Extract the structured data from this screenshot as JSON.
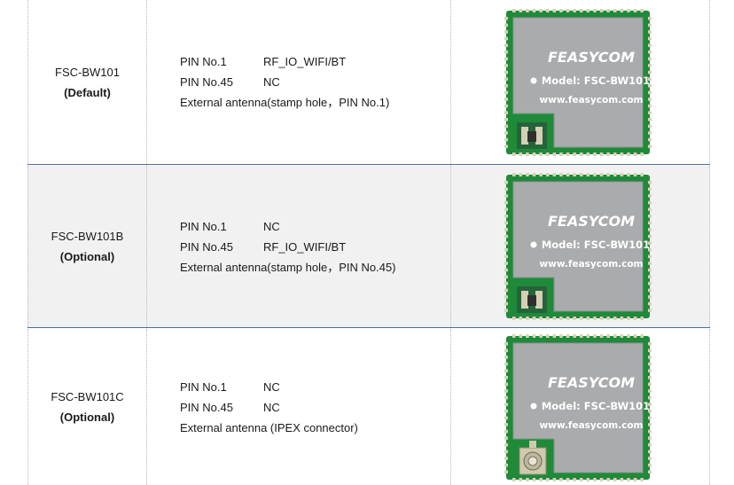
{
  "rows": [
    {
      "model": "FSC-BW101",
      "variant": "(Default)",
      "pins": [
        {
          "pin": "PIN No.1",
          "function": "RF_IO_WIFI/BT"
        },
        {
          "pin": "PIN No.45",
          "function": "NC"
        }
      ],
      "antenna": "External antenna(stamp hole，PIN No.1)",
      "image": {
        "brand": "FEASYCOM",
        "model_text": "Model: FSC-BW101",
        "url": "www.feasycom.com",
        "connector_icon": "stamp-hole-pad-icon"
      }
    },
    {
      "model": "FSC-BW101B",
      "variant": "(Optional)",
      "pins": [
        {
          "pin": "PIN No.1",
          "function": "NC"
        },
        {
          "pin": "PIN No.45",
          "function": "RF_IO_WIFI/BT"
        }
      ],
      "antenna": "External antenna(stamp hole，PIN No.45)",
      "image": {
        "brand": "FEASYCOM",
        "model_text": "Model: FSC-BW101",
        "url": "www.feasycom.com",
        "connector_icon": "stamp-hole-pad-icon"
      }
    },
    {
      "model": "FSC-BW101C",
      "variant": "(Optional)",
      "pins": [
        {
          "pin": "PIN No.1",
          "function": "NC"
        },
        {
          "pin": "PIN No.45",
          "function": "NC"
        }
      ],
      "antenna": "External antenna (IPEX connector)",
      "image": {
        "brand": "FEASYCOM",
        "model_text": "Model: FSC-BW101",
        "url": "www.feasycom.com",
        "connector_icon": "ipex-connector-icon"
      }
    }
  ],
  "colors": {
    "pcb": "#1f8a3a",
    "shield": "#a9abad",
    "border": "#4a6f9f",
    "alt_row": "#f1f1f1"
  }
}
